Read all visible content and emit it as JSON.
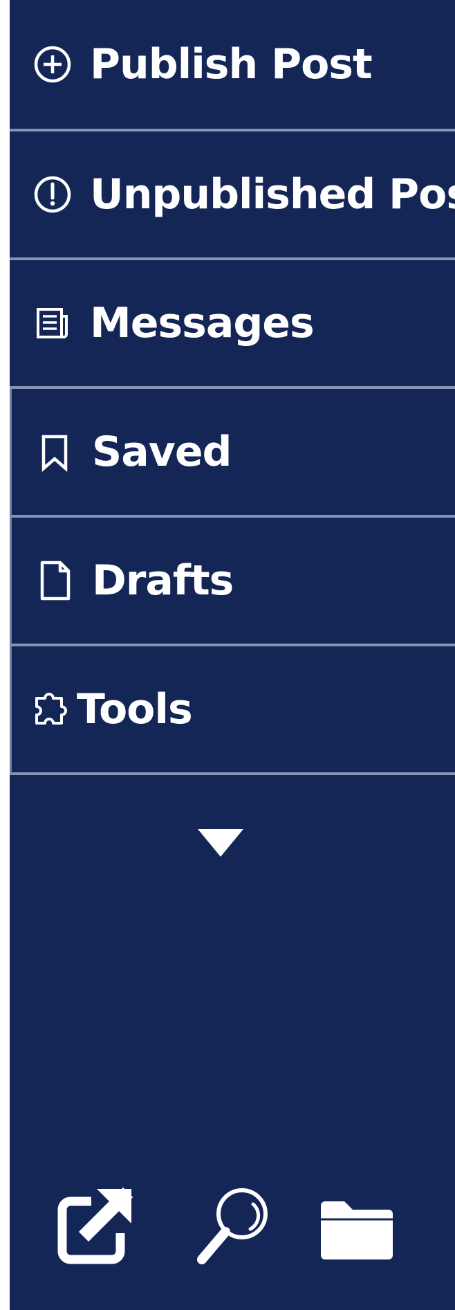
{
  "sidebar": {
    "items": [
      {
        "label": "Publish Post",
        "icon": "plus-circle-icon"
      },
      {
        "label": "Unpublished Posts",
        "icon": "exclamation-circle-icon"
      },
      {
        "label": "Messages",
        "icon": "newspaper-icon"
      },
      {
        "label": "Saved",
        "icon": "bookmark-icon"
      },
      {
        "label": "Drafts",
        "icon": "document-icon"
      },
      {
        "label": "Tools",
        "icon": "puzzle-piece-icon"
      }
    ],
    "expand_icon": "triangle-down-icon"
  },
  "bottom_toolbar": {
    "icons": [
      "external-link-icon",
      "search-icon",
      "folder-icon"
    ]
  },
  "colors": {
    "background": "#142656",
    "divider": "#8693b5",
    "foreground": "#ffffff"
  }
}
